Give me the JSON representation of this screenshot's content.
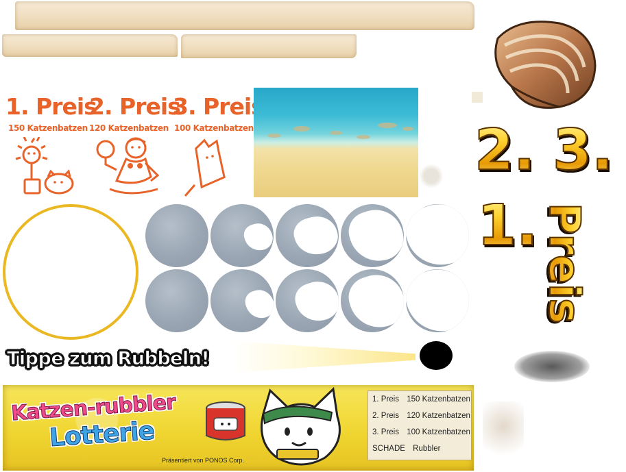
{
  "prizes": [
    {
      "title": "1. Preis",
      "amount": "150 Katzenbatzen",
      "icon": "sunflower-cat-icon"
    },
    {
      "title": "2. Preis",
      "amount": "120 Katzenbatzen",
      "icon": "beach-cat-icon"
    },
    {
      "title": "3. Preis",
      "amount": "100 Katzenbatzen",
      "icon": "popsicle-cat-icon"
    }
  ],
  "gold_labels": {
    "second": "2.",
    "third": "3.",
    "first": "1.",
    "word": "Preis"
  },
  "tap_prompt": "Tippe zum Rubbeln!",
  "banner": {
    "title_line1": "Katzen-rubbler",
    "title_line2": "Lotterie",
    "presented_by": "Präsentiert von PONOS Corp.",
    "rows": [
      {
        "rank": "1. Preis",
        "amount": "150 Katzenbatzen"
      },
      {
        "rank": "2. Preis",
        "amount": "120 Katzenbatzen"
      },
      {
        "rank": "3. Preis",
        "amount": "100 Katzenbatzen"
      },
      {
        "rank": "SCHADE",
        "amount": "Rubbler"
      }
    ]
  },
  "scratch_spots": {
    "row1_progress": [
      0.0,
      0.25,
      0.5,
      0.75,
      1.0
    ],
    "row2_progress": [
      0.0,
      0.25,
      0.5,
      0.75,
      1.0
    ]
  },
  "colors": {
    "prize_orange": "#e8632a",
    "ring_gold": "#e9b823",
    "banner_yellow": "#f0d632",
    "scratch_grey": "#9aa6b3"
  }
}
